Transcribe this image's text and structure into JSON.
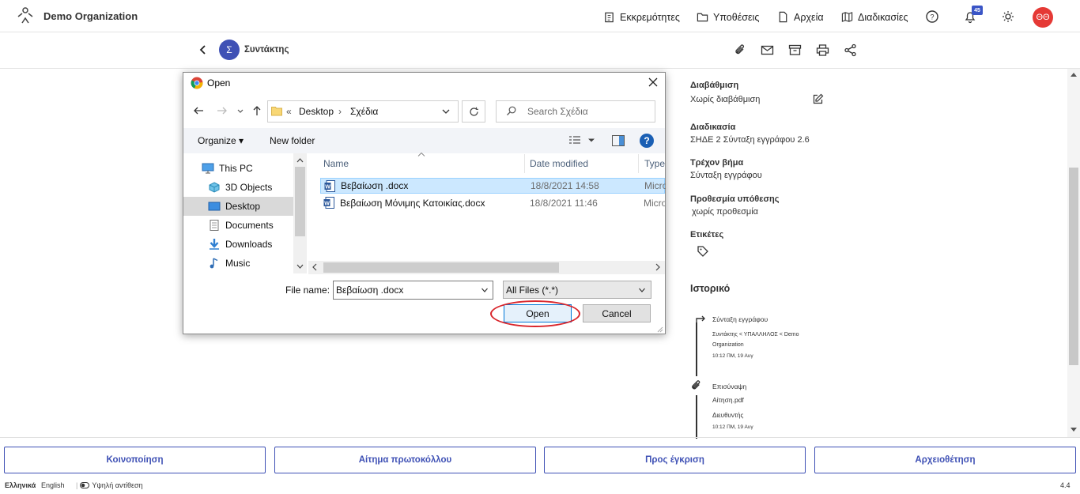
{
  "app": {
    "org_name": "Demo Organization",
    "nav": {
      "pending": "Εκκρεμότητες",
      "cases": "Υποθέσεις",
      "files": "Αρχεία",
      "procedures": "Διαδικασίες"
    },
    "notifications_count": "45",
    "user_initials": "ΘΘ"
  },
  "toolbar": {
    "author_initial": "Σ",
    "author_label": "Συντάκτης"
  },
  "panel": {
    "grading_label": "Διαβάθμιση",
    "grading_value": "Χωρίς διαβάθμιση",
    "procedure_label": "Διαδικασία",
    "procedure_value": "ΣΗΔΕ 2 Σύνταξη εγγράφου 2.6",
    "step_label": "Τρέχον βήμα",
    "step_value": "Σύνταξη εγγράφου",
    "deadline_label": "Προθεσμία υπόθεσης",
    "deadline_value": "χωρίς προθεσμία",
    "tags_label": "Ετικέτες",
    "history_title": "Ιστορικό",
    "history": [
      {
        "title": "Σύνταξη εγγράφου",
        "detail": "Συντάκτης < ΥΠΑΛΛΗΛΟΣ < Demo",
        "detail2": "Organization",
        "time": "10:12 ΠΜ, 19 Αυγ"
      },
      {
        "title": "Επισύναψη",
        "detail": "Αίτηση.pdf",
        "detail2": "Διευθυντής",
        "time": "10:12 ΠΜ, 19 Αυγ"
      }
    ]
  },
  "bottom": {
    "share": "Κοινοποίηση",
    "protocol": "Αίτημα πρωτοκόλλου",
    "approval": "Προς έγκριση",
    "archive": "Αρχειοθέτηση"
  },
  "footer": {
    "lang_el": "Ελληνικά",
    "lang_en": "English",
    "contrast": "Υψηλή αντίθεση",
    "version": "4.4"
  },
  "dialog": {
    "title": "Open",
    "address": {
      "prefix": "«",
      "desktop": "Desktop",
      "sep": "›",
      "folder": "Σχέδια"
    },
    "search_placeholder": "Search Σχέδια",
    "organize": "Organize ▾",
    "new_folder": "New folder",
    "tree": [
      "This PC",
      "3D Objects",
      "Desktop",
      "Documents",
      "Downloads",
      "Music"
    ],
    "columns": {
      "name": "Name",
      "date": "Date modified",
      "type": "Type"
    },
    "files": [
      {
        "name": "Βεβαίωση .docx",
        "date": "18/8/2021 14:58",
        "type": "Micro"
      },
      {
        "name": "Βεβαίωση Μόνιμης Κατοικίας.docx",
        "date": "18/8/2021 11:46",
        "type": "Micro"
      }
    ],
    "file_name_label": "File name:",
    "file_name_value": "Βεβαίωση .docx",
    "filter_value": "All Files (*.*)",
    "open": "Open",
    "cancel": "Cancel"
  },
  "colors": {
    "accent": "#3f51b5",
    "avatar_red": "#e53935",
    "highlight": "#d9262c"
  }
}
